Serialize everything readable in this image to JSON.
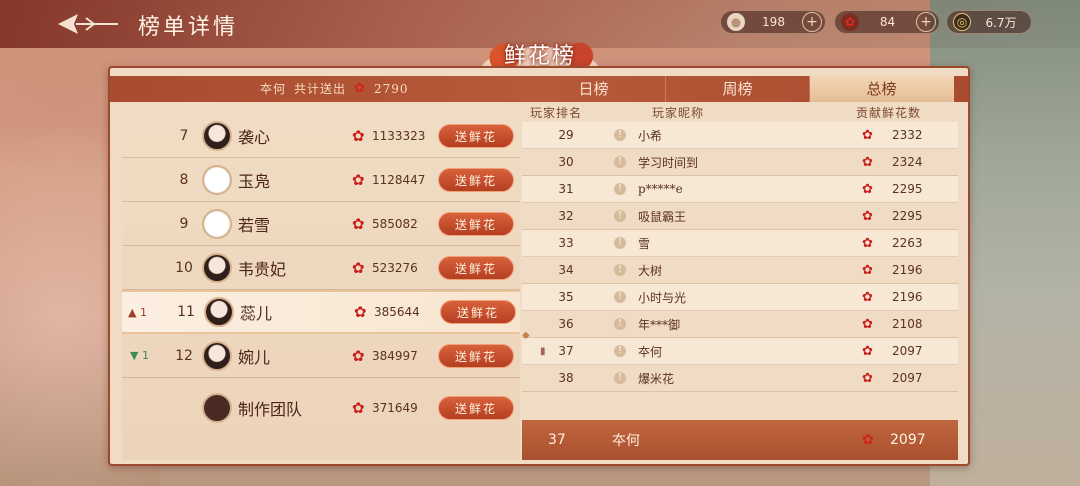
{
  "header": {
    "title": "榜单详情",
    "resources": [
      {
        "icon": "egg-icon",
        "value": "198"
      },
      {
        "icon": "rose-icon",
        "value": "84"
      },
      {
        "icon": "coin-icon",
        "value": "6.7万"
      }
    ]
  },
  "board": {
    "title": "鲜花榜",
    "me_name": "夲何",
    "me_total_label": "共计送出",
    "me_total": "2790",
    "tabs": [
      "日榜",
      "周榜",
      "总榜"
    ],
    "active_tab": "总榜",
    "columns": [
      "玩家排名",
      "玩家昵称",
      "贡献鲜花数"
    ]
  },
  "left_list": [
    {
      "rank": "7",
      "name": "袭心",
      "amount": "1133323",
      "button": "送鲜花",
      "avatar": "dark",
      "trend": "",
      "trend_value": ""
    },
    {
      "rank": "8",
      "name": "玉凫",
      "amount": "1128447",
      "button": "送鲜花",
      "avatar": "white",
      "trend": "",
      "trend_value": ""
    },
    {
      "rank": "9",
      "name": "若雪",
      "amount": "585082",
      "button": "送鲜花",
      "avatar": "white",
      "trend": "",
      "trend_value": ""
    },
    {
      "rank": "10",
      "name": "韦贵妃",
      "amount": "523276",
      "button": "送鲜花",
      "avatar": "dark",
      "trend": "",
      "trend_value": ""
    },
    {
      "rank": "11",
      "name": "蕊儿",
      "amount": "385644",
      "button": "送鲜花",
      "avatar": "dark",
      "trend": "up",
      "trend_value": "1"
    },
    {
      "rank": "12",
      "name": "婉儿",
      "amount": "384997",
      "button": "送鲜花",
      "avatar": "dark",
      "trend": "down",
      "trend_value": "1"
    },
    {
      "rank": "",
      "name": "制作团队",
      "amount": "371649",
      "button": "送鲜花",
      "avatar": "team",
      "trend": "",
      "trend_value": ""
    }
  ],
  "right_list": [
    {
      "rank": "29",
      "name": "小希",
      "amount": "2332"
    },
    {
      "rank": "30",
      "name": "学习时间到",
      "amount": "2324"
    },
    {
      "rank": "31",
      "name": "p*****e",
      "amount": "2295"
    },
    {
      "rank": "32",
      "name": "吸鼠霸王",
      "amount": "2295"
    },
    {
      "rank": "33",
      "name": "雪",
      "amount": "2263"
    },
    {
      "rank": "34",
      "name": "大树",
      "amount": "2196"
    },
    {
      "rank": "35",
      "name": "小时与光",
      "amount": "2196"
    },
    {
      "rank": "36",
      "name": "年***御",
      "amount": "2108"
    },
    {
      "rank": "37",
      "name": "夲何",
      "amount": "2097"
    },
    {
      "rank": "38",
      "name": "爆米花",
      "amount": "2097"
    }
  ],
  "my_row": {
    "rank": "37",
    "name": "夲何",
    "amount": "2097"
  }
}
